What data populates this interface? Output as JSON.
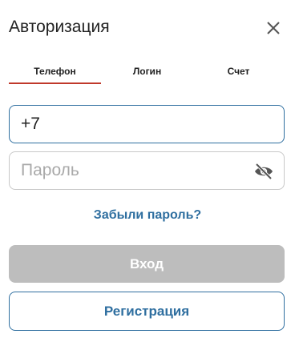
{
  "modal": {
    "title": "Авторизация",
    "close_icon": "close-icon"
  },
  "tabs": [
    {
      "label": "Телефон",
      "active": true
    },
    {
      "label": "Логин",
      "active": false
    },
    {
      "label": "Счет",
      "active": false
    }
  ],
  "phone_field": {
    "value": "+7"
  },
  "password_field": {
    "placeholder": "Пароль",
    "toggle_icon": "eye-slash-icon"
  },
  "forgot_link": "Забыли пароль?",
  "login_button": "Вход",
  "register_button": "Регистрация",
  "colors": {
    "accent_blue": "#2f6fa0",
    "tab_underline": "#c0392b",
    "disabled_button": "#bdbdbd"
  }
}
